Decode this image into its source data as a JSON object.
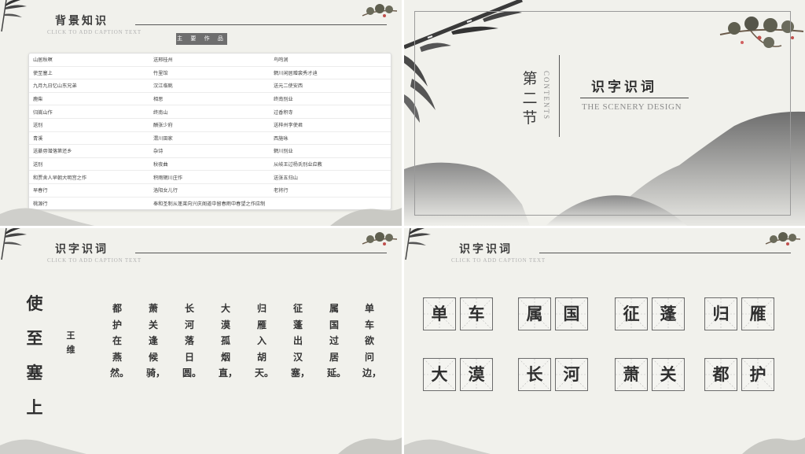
{
  "slide1": {
    "title": "背景知识",
    "subtitle": "CLICK TO ADD CAPTION TEXT",
    "works_label": "主 要 作 品",
    "rows": [
      [
        "山居秋暝",
        "送邢桂州",
        "鸟鸣涧"
      ],
      [
        "使至塞上",
        "竹里馆",
        "辋川闲居赠裴秀才迪"
      ],
      [
        "九月九日忆山东兄弟",
        "汉江临眺",
        "送元二使安西"
      ],
      [
        "鹿柴",
        "相思",
        "终南别业"
      ],
      [
        "归嵩山作",
        "终南山",
        "过香积寺"
      ],
      [
        "送别",
        "酬张少府",
        "送梓州李使君"
      ],
      [
        "青溪",
        "渭川田家",
        "西施咏"
      ],
      [
        "送綦毋潜落第还乡",
        "杂诗",
        "辋川别业"
      ],
      [
        "送别",
        "秋夜曲",
        "从岐王过杨氏别业应教"
      ],
      [
        "和贾舍人早朝大明宫之作",
        "积雨辋川庄作",
        "送张五归山"
      ],
      [
        "早春行",
        "洛阳女儿行",
        "老将行"
      ]
    ],
    "last_row": [
      "桃源行",
      "奉和圣制从蓬莱向兴庆阁道中留春雨中春望之作应制"
    ]
  },
  "slide2": {
    "section": "第二节",
    "contents": "CONTENTS",
    "title": "识字识词",
    "subtitle": "THE SCENERY DESIGN"
  },
  "slide3": {
    "title": "识字识词",
    "subtitle": "CLICK TO ADD CAPTION TEXT",
    "poem_title": "使至塞上",
    "author": "王维",
    "lines": [
      "单车欲问边，",
      "属国过居延。",
      "征蓬出汉塞，",
      "归雁入胡天。",
      "大漠孤烟直，",
      "长河落日圆。",
      "萧关逢候骑，",
      "都护在燕然。"
    ]
  },
  "slide4": {
    "title": "识字识词",
    "subtitle": "CLICK TO ADD CAPTION TEXT",
    "words": [
      [
        "单",
        "车"
      ],
      [
        "属",
        "国"
      ],
      [
        "征",
        "蓬"
      ],
      [
        "归",
        "雁"
      ],
      [
        "大",
        "漠"
      ],
      [
        "长",
        "河"
      ],
      [
        "萧",
        "关"
      ],
      [
        "都",
        "护"
      ]
    ]
  },
  "icons": {
    "bamboo": "bamboo-icon",
    "pine": "pine-branch-icon",
    "mountain": "ink-mountain-icon"
  },
  "colors": {
    "paper": "#f1f1ec",
    "ink": "#3a3a3a",
    "label_bg": "#6e6e6e"
  }
}
